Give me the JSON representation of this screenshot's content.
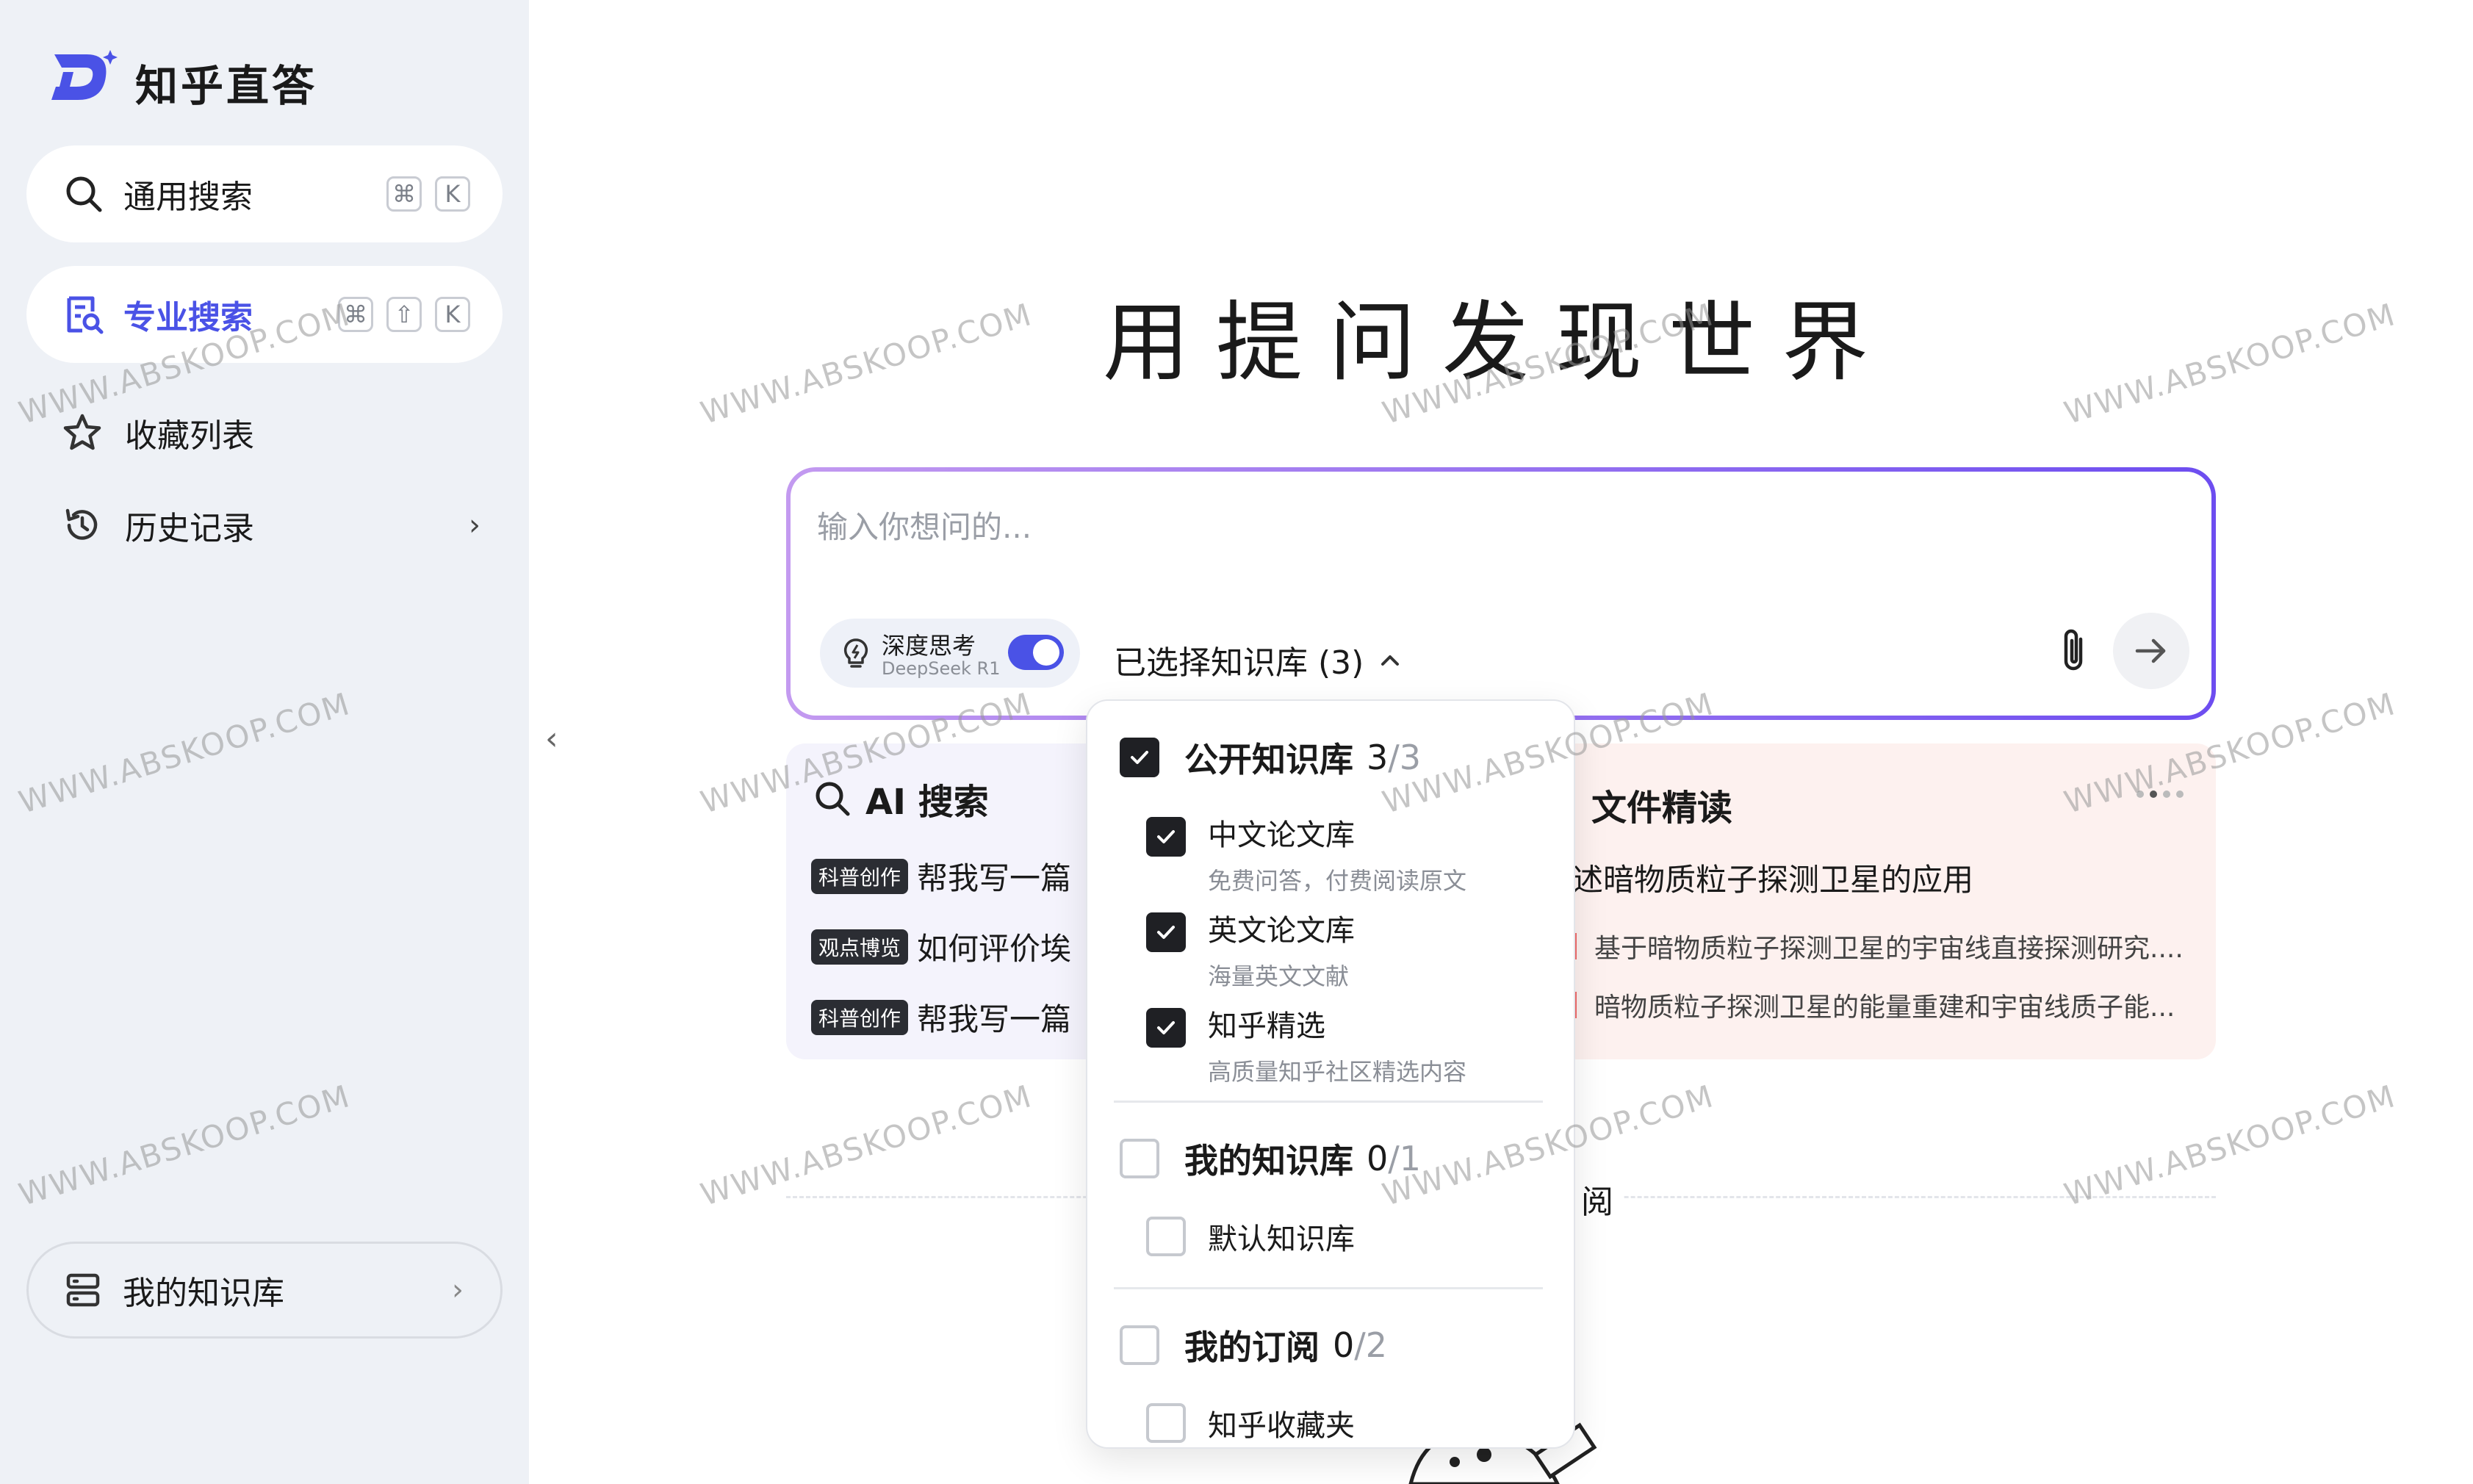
{
  "app": {
    "title": "知乎直答"
  },
  "sidebar": {
    "general_search": {
      "label": "通用搜索",
      "keys": [
        "⌘",
        "K"
      ]
    },
    "pro_search": {
      "label": "专业搜索",
      "keys": [
        "⌘",
        "⇧",
        "K"
      ]
    },
    "favorites": {
      "label": "收藏列表"
    },
    "history": {
      "label": "历史记录"
    },
    "my_kb": {
      "label": "我的知识库"
    }
  },
  "main": {
    "hero": "用提问发现世界",
    "input_placeholder": "输入你想问的...",
    "deep_think": {
      "label": "深度思考",
      "sub": "DeepSeek R1",
      "enabled": true
    },
    "kb_selected": "已选择知识库 (3)",
    "cards": {
      "ai_search": {
        "title": "AI 搜索",
        "items": [
          {
            "tag": "科普创作",
            "text": "帮我写一篇"
          },
          {
            "tag": "观点博览",
            "text": "如何评价埃"
          },
          {
            "tag": "科普创作",
            "text": "帮我写一篇"
          }
        ]
      },
      "file_read": {
        "title": "文件精读",
        "headline": "述暗物质粒子探测卫星的应用",
        "refs": [
          "基于暗物质粒子探测卫星的宇宙线直接探测研究....",
          "暗物质粒子探测卫星的能量重建和宇宙线质子能..."
        ]
      }
    },
    "partial_text": "阅"
  },
  "dropdown": {
    "groups": [
      {
        "title": "公开知识库",
        "selected": "3",
        "total": "/3",
        "checked": true,
        "items": [
          {
            "name": "中文论文库",
            "desc": "免费问答，付费阅读原文",
            "checked": true
          },
          {
            "name": "英文论文库",
            "desc": "海量英文文献",
            "checked": true
          },
          {
            "name": "知乎精选",
            "desc": "高质量知乎社区精选内容",
            "checked": true
          }
        ]
      },
      {
        "title": "我的知识库",
        "selected": "0",
        "total": "/1",
        "checked": false,
        "items": [
          {
            "name": "默认知识库",
            "checked": false
          }
        ]
      },
      {
        "title": "我的订阅",
        "selected": "0",
        "total": "/2",
        "checked": false,
        "items": [
          {
            "name": "知乎收藏夹",
            "checked": false
          }
        ]
      }
    ]
  },
  "watermark": "WWW.ABSKOOP.COM",
  "colors": {
    "accent": "#4a52e6",
    "sidebar_bg": "#eef1f6",
    "ai_card_bg": "#f4f3fc",
    "file_card_bg": "#fdf1ef"
  }
}
